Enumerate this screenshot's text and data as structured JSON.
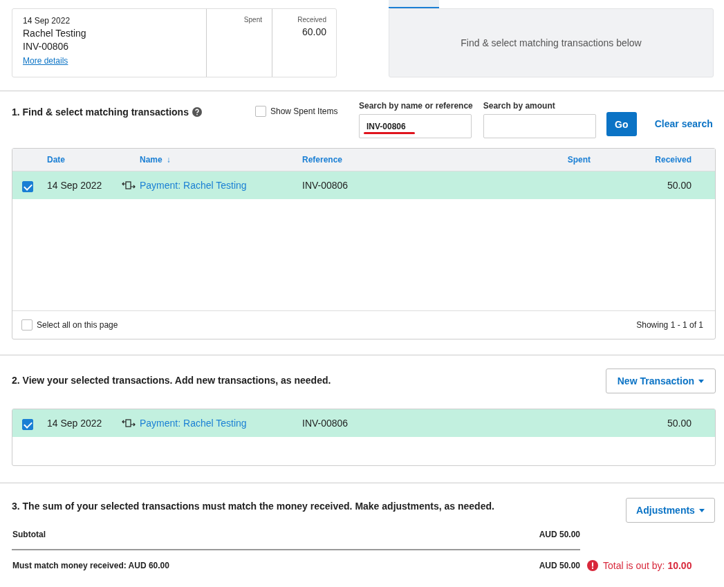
{
  "statement": {
    "date": "14 Sep 2022",
    "payee": "Rachel Testing",
    "reference": "INV-00806",
    "details_link": "More details",
    "spent_label": "Spent",
    "received_label": "Received",
    "received": "60.00"
  },
  "tabs": [
    {
      "selected": true
    }
  ],
  "match_panel": {
    "message": "Find & select matching transactions below"
  },
  "find_section": {
    "title": "1. Find & select matching transactions",
    "show_spent": {
      "label": "Show Spent Items",
      "checked": false
    },
    "search_name": {
      "label": "Search by name or reference",
      "value": "INV-00806"
    },
    "search_amount": {
      "label": "Search by amount"
    },
    "go_button": "Go",
    "clear_link": "Clear search",
    "table": {
      "columns": [
        {
          "label": "Date"
        },
        {
          "label": "Name",
          "sort": "↓"
        },
        {
          "label": "Reference"
        },
        {
          "label": "Spent"
        },
        {
          "label": "Received"
        }
      ],
      "rows": [
        {
          "checked": true,
          "date": "14 Sep 2022",
          "name": "Payment: Rachel Testing",
          "reference": "INV-00806",
          "received": "50.00"
        }
      ]
    },
    "select_all": {
      "label": "Select all on this page",
      "checked": false
    },
    "showing": "Showing 1 - 1 of 1"
  },
  "selected_section": {
    "title": "2. View your selected transactions. Add new transactions, as needed.",
    "button": "New Transaction",
    "rows": [
      {
        "checked": true,
        "date": "14 Sep 2022",
        "name": "Payment: Rachel Testing",
        "reference": "INV-00806",
        "received": "50.00"
      }
    ]
  },
  "summary_section": {
    "title": "3. The sum of your selected transactions must match the money received. Make adjustments, as needed.",
    "button": "Adjustments",
    "subtotal_label": "Subtotal",
    "subtotal": "AUD 50.00",
    "must_match_label": "Must match money received: AUD 60.00",
    "total": "AUD 50.00",
    "warning": "Total is out by: **10.00**"
  }
}
